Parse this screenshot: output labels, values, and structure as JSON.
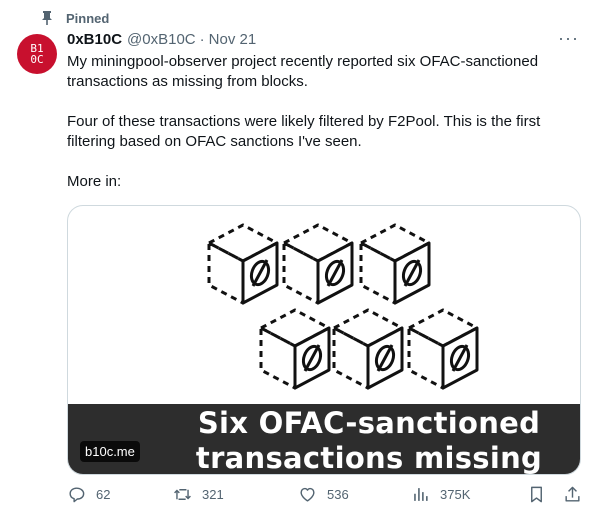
{
  "pinned": {
    "label": "Pinned",
    "icon": "pin-icon"
  },
  "author": {
    "avatar_lines": [
      "B1",
      "0C"
    ],
    "name": "0xB10C",
    "handle": "@0xB10C",
    "separator": "·",
    "date": "Nov 21"
  },
  "more_label": "···",
  "tweet": {
    "paragraphs": [
      "My miningpool-observer project recently reported six OFAC-sanctioned transactions as missing from blocks.",
      "Four of these transactions were likely filtered by F2Pool. This is the first filtering based on OFAC sanctions I've seen.",
      "More in:"
    ]
  },
  "card": {
    "headline_line1": "Six OFAC-sanctioned",
    "headline_line2": "transactions missing",
    "domain": "b10c.me"
  },
  "actions": {
    "replies": {
      "icon": "reply-icon",
      "count": "62"
    },
    "retweets": {
      "icon": "retweet-icon",
      "count": "321"
    },
    "likes": {
      "icon": "heart-icon",
      "count": "536"
    },
    "views": {
      "icon": "views-icon",
      "count": "375K"
    },
    "bookmark": {
      "icon": "bookmark-icon"
    },
    "share": {
      "icon": "share-icon"
    }
  },
  "colors": {
    "avatar_bg": "#c8102e",
    "muted": "#536471",
    "banner_bg": "#2d2d2d"
  }
}
